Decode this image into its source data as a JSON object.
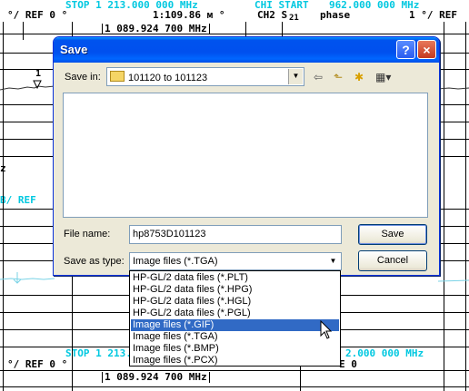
{
  "background": {
    "top_left_stop": "STOP 1 213.000 000 MHz",
    "top_right_chi": "CHI START",
    "top_right_freq": "962.000 000 MHz",
    "row2_ref": "°/   REF 0 °",
    "row2_span": "1:109.86 м  °",
    "row2_ch2": "CH2 S",
    "row2_sub": "21",
    "row2_phase": "phase",
    "row2_scale": "1 °/  REF",
    "marker_box_top": "1 089.924 700 MHz",
    "left_frag_1": "z",
    "left_frag_2": "B/   REF",
    "bottom_stop": "STOP 1 213.",
    "bottom_right_freq": "2.000 000 MHz",
    "bottom_row2": "°/   REF 0 °",
    "marker_box_bottom": "1 089.924 700 MHz",
    "bottom_right_ref": "E 0",
    "marker_label": "1"
  },
  "dialog": {
    "title": "Save",
    "help_glyph": "?",
    "close_glyph": "×",
    "save_in_label": "Save in:",
    "save_in_value": "101120 to 101123",
    "file_name_label": "File name:",
    "file_name_value": "hp8753D101123",
    "save_as_type_label": "Save as type:",
    "save_as_type_value": "Image files (*.TGA)",
    "save_button": "Save",
    "cancel_button": "Cancel",
    "toolbar": {
      "back": "⇦",
      "up": "⬑",
      "new_folder": "✱",
      "views": "▦▾"
    }
  },
  "dropdown": {
    "options": [
      "HP-GL/2 data files (*.PLT)",
      "HP-GL/2 data files (*.HPG)",
      "HP-GL/2 data files (*.HGL)",
      "HP-GL/2 data files (*.PGL)",
      "Image files (*.GIF)",
      "Image files (*.TGA)",
      "Image files (*.BMP)",
      "Image files (*.PCX)"
    ],
    "selected_index": 4
  }
}
